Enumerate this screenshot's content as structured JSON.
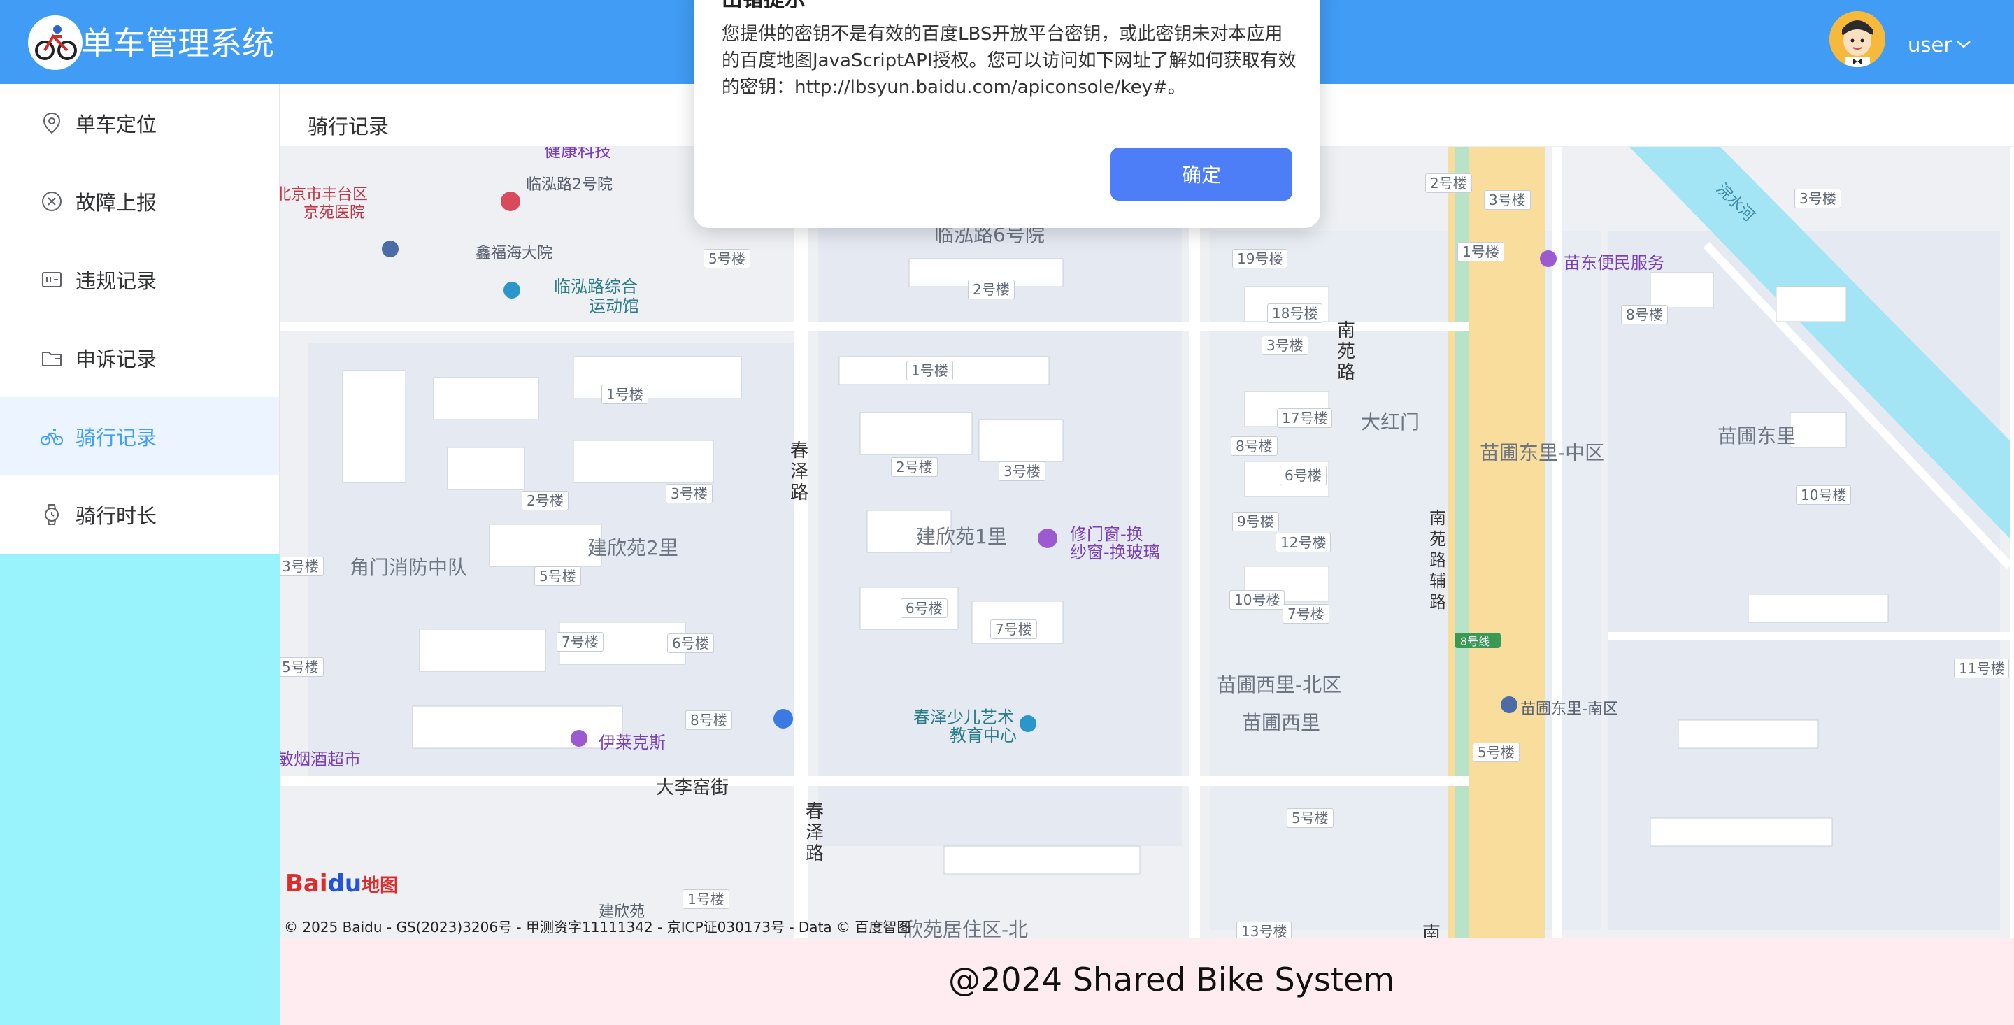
{
  "header": {
    "app_title": "单车管理系统",
    "user_name": "user",
    "brand_color": "#409cf4"
  },
  "sidebar": {
    "items": [
      {
        "label": "单车定位",
        "icon": "location-pin-icon"
      },
      {
        "label": "故障上报",
        "icon": "circle-x-icon"
      },
      {
        "label": "违规记录",
        "icon": "record-card-icon"
      },
      {
        "label": "申诉记录",
        "icon": "folder-icon"
      },
      {
        "label": "骑行记录",
        "icon": "bicycle-icon",
        "active": true
      },
      {
        "label": "骑行时长",
        "icon": "watch-icon"
      }
    ],
    "active_color": "#409eff",
    "background": "#99f3fc"
  },
  "breadcrumb": {
    "current": "骑行记录"
  },
  "map": {
    "labels": {
      "l1": "健康科技",
      "l2": "临泓路2号院",
      "l3": "北京市丰台区",
      "l4": "京苑医院",
      "l5": "鑫福海大院",
      "l6": "临泓路综合",
      "l7": "运动馆",
      "l8": "临泓路6号院",
      "l9": "南苑路",
      "l10": "大红门",
      "l11": "苗圃东里-中区",
      "l12": "苗圃东里",
      "l13": "苗东便民服务",
      "l14": "浣水河",
      "l15": "春泽路",
      "l16": "建欣苑1里",
      "l17": "修门窗-换",
      "l18": "纱窗-换玻璃",
      "l19": "建欣苑2里",
      "l20": "角门消防中队",
      "l21": "南苑路辅路",
      "l22": "苗圃西里-北区",
      "l23": "苗圃西里",
      "l24": "苗圃东里-南区",
      "l25": "春泽少儿艺术",
      "l26": "教育中心",
      "l27": "伊莱克斯",
      "l28": "大李窑街",
      "l29": "春泽路",
      "l30": "敏烟酒超市",
      "l31": "建欣苑",
      "l32": "欣苑居住区-北",
      "l33": "南",
      "l34": "8号线"
    },
    "buildings": {
      "b1": "5号楼",
      "b2": "2号楼",
      "b3": "1号楼",
      "b4": "1号楼",
      "b5": "2号楼",
      "b6": "3号楼",
      "b7": "2号楼",
      "b8": "3号楼",
      "b9": "5号楼",
      "b10": "3号楼",
      "b11": "6号楼",
      "b12": "7号楼",
      "b13": "7号楼",
      "b14": "6号楼",
      "b15": "8号楼",
      "b16": "5号楼",
      "b17": "1号楼",
      "b18": "2号楼",
      "b19": "3号楼",
      "b20": "1号楼",
      "b21": "8号楼",
      "b22": "19号楼",
      "b23": "18号楼",
      "b24": "3号楼",
      "b25": "17号楼",
      "b26": "8号楼",
      "b27": "6号楼",
      "b28": "9号楼",
      "b29": "12号楼",
      "b30": "10号楼",
      "b31": "7号楼",
      "b32": "10号楼",
      "b33": "11号楼",
      "b34": "5号楼",
      "b35": "5号楼",
      "b36": "13号楼",
      "b37": "3号楼"
    },
    "baidu_logo_a": "Bai",
    "baidu_logo_b": "du",
    "baidu_logo_c": "地图",
    "copyright": "© 2025 Baidu - GS(2023)3206号 - 甲测资字11111342 - 京ICP证030173号 - Data © 百度智图"
  },
  "dialog": {
    "title": "出错提示",
    "message": "您提供的密钥不是有效的百度LBS开放平台密钥，或此密钥未对本应用的百度地图JavaScriptAPI授权。您可以访问如下网址了解如何获取有效的密钥：http://lbsyun.baidu.com/apiconsole/key#。",
    "confirm_label": "确定",
    "button_color": "#4d7ef7"
  },
  "footer": {
    "text": "@2024 Shared Bike System",
    "background": "#ffecf0"
  }
}
